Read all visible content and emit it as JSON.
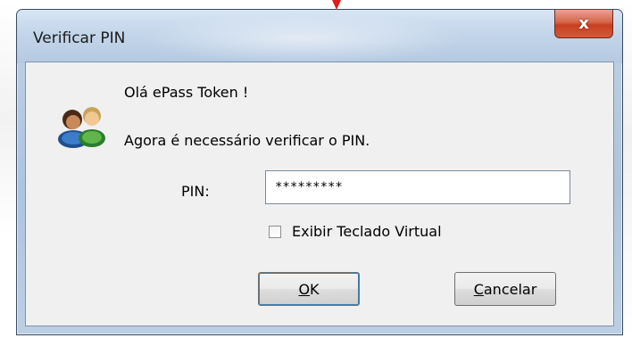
{
  "window": {
    "title": "Verificar PIN",
    "close_symbol": "x"
  },
  "dialog": {
    "greeting": "Olá ePass Token !",
    "instruction": "Agora é necessário verificar o PIN.",
    "pin_label": "PIN:",
    "pin_value": "*********",
    "checkbox_label": "Exibir Teclado Virtual",
    "checkbox_checked": false,
    "ok_label_mnemonic": "O",
    "ok_label_rest": "K",
    "cancel_label_mnemonic": "C",
    "cancel_label_rest": "ancelar",
    "icon": "users-icon"
  },
  "colors": {
    "marker": "#e21b1b",
    "close_button": "#c7401f",
    "frame": "#b9cde3"
  }
}
